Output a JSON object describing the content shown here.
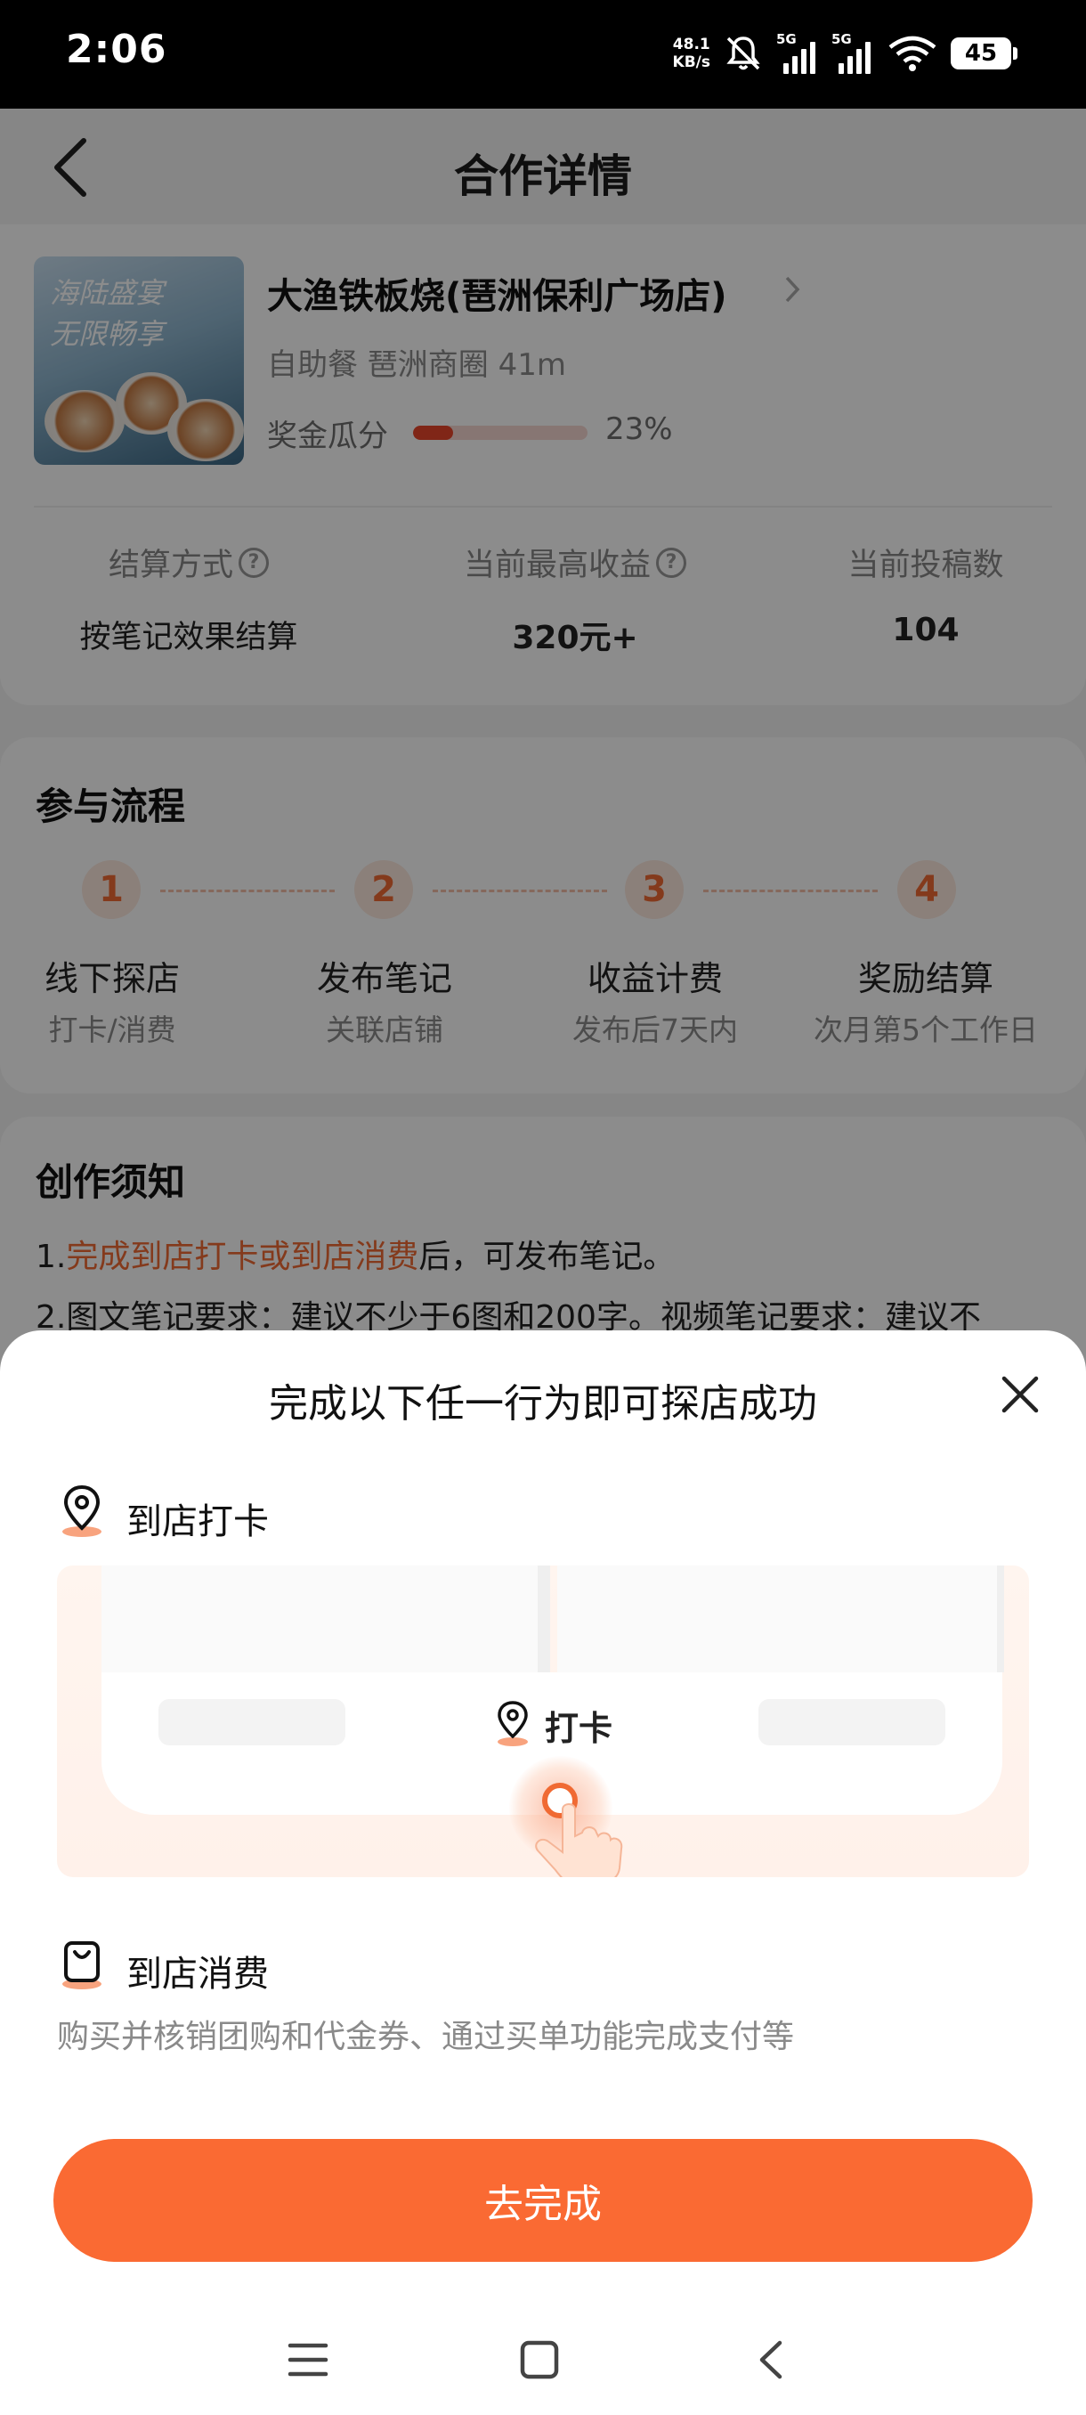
{
  "status_bar": {
    "time": "2:06",
    "net_speed_value": "48.1",
    "net_speed_unit": "KB/s",
    "sim1": "5G",
    "sim2": "5G",
    "battery": "45"
  },
  "header": {
    "title": "合作详情"
  },
  "store": {
    "name": "大渔铁板烧(琶洲保利广场店)",
    "meta": "自助餐 琶洲商圈 41m",
    "bonus_label": "奖金瓜分",
    "bonus_progress": 0.23,
    "bonus_percent_text": "23%",
    "thumb_text_line1": "海陆盛宴",
    "thumb_text_line2": "无限畅享"
  },
  "stats": [
    {
      "label": "结算方式",
      "value": "按笔记效果结算",
      "has_help": true
    },
    {
      "label": "当前最高收益",
      "value": "320元+",
      "has_help": true
    },
    {
      "label": "当前投稿数",
      "value": "104",
      "has_help": false
    }
  ],
  "process": {
    "title": "参与流程",
    "steps": [
      {
        "num": "1",
        "name": "线下探店",
        "desc": "打卡/消费"
      },
      {
        "num": "2",
        "name": "发布笔记",
        "desc": "关联店铺"
      },
      {
        "num": "3",
        "name": "收益计费",
        "desc": "发布后7天内"
      },
      {
        "num": "4",
        "name": "奖励结算",
        "desc": "次月第5个工作日"
      }
    ]
  },
  "notice": {
    "title": "创作须知",
    "rule1_prefix": "1.",
    "rule1_highlight": "完成到店打卡或到店消费",
    "rule1_suffix": "后，可发布笔记。",
    "rule2": "2.图文笔记要求：建议不少于6图和200字。视频笔记要求：建议不"
  },
  "sheet": {
    "title": "完成以下任一行为即可探店成功",
    "option1": {
      "label": "到店打卡",
      "icon": "location-pin-icon"
    },
    "illustration": {
      "checkin_label": "打卡"
    },
    "option2": {
      "label": "到店消费",
      "icon": "shopping-bag-icon",
      "desc": "购买并核销团购和代金券、通过买单功能完成支付等"
    },
    "cta": "去完成"
  },
  "colors": {
    "accent": "#fa6a33",
    "highlight_text": "#f06a33",
    "bonus_fill": "#e9452b",
    "step_bg": "#fde9df"
  }
}
